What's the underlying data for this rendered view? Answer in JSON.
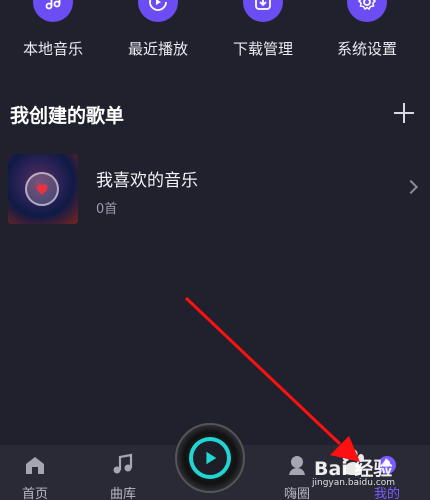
{
  "quick_actions": [
    {
      "label": "本地音乐",
      "icon": "music-note-icon"
    },
    {
      "label": "最近播放",
      "icon": "recent-play-icon"
    },
    {
      "label": "下载管理",
      "icon": "download-icon"
    },
    {
      "label": "系统设置",
      "icon": "gear-icon"
    }
  ],
  "section": {
    "title": "我创建的歌单",
    "add_icon": "plus-icon"
  },
  "playlist": {
    "name": "我喜欢的音乐",
    "count": "0首",
    "cover_icon": "heart-icon"
  },
  "bottom_nav": [
    {
      "label": "首页",
      "icon": "home-icon",
      "active": false
    },
    {
      "label": "曲库",
      "icon": "music-library-icon",
      "active": false
    },
    {
      "label": "嗨圈",
      "icon": "community-icon",
      "active": false
    },
    {
      "label": "我的",
      "icon": "profile-icon",
      "active": true
    }
  ],
  "watermark": {
    "text": "Bai 经验",
    "url": "jingyan.baidu.com"
  },
  "colors": {
    "background": "#21212d",
    "accent": "#6c4cf3",
    "active_tab": "#7a5cff",
    "play_ring": "#21d5d2",
    "arrow": "#ff1010"
  }
}
